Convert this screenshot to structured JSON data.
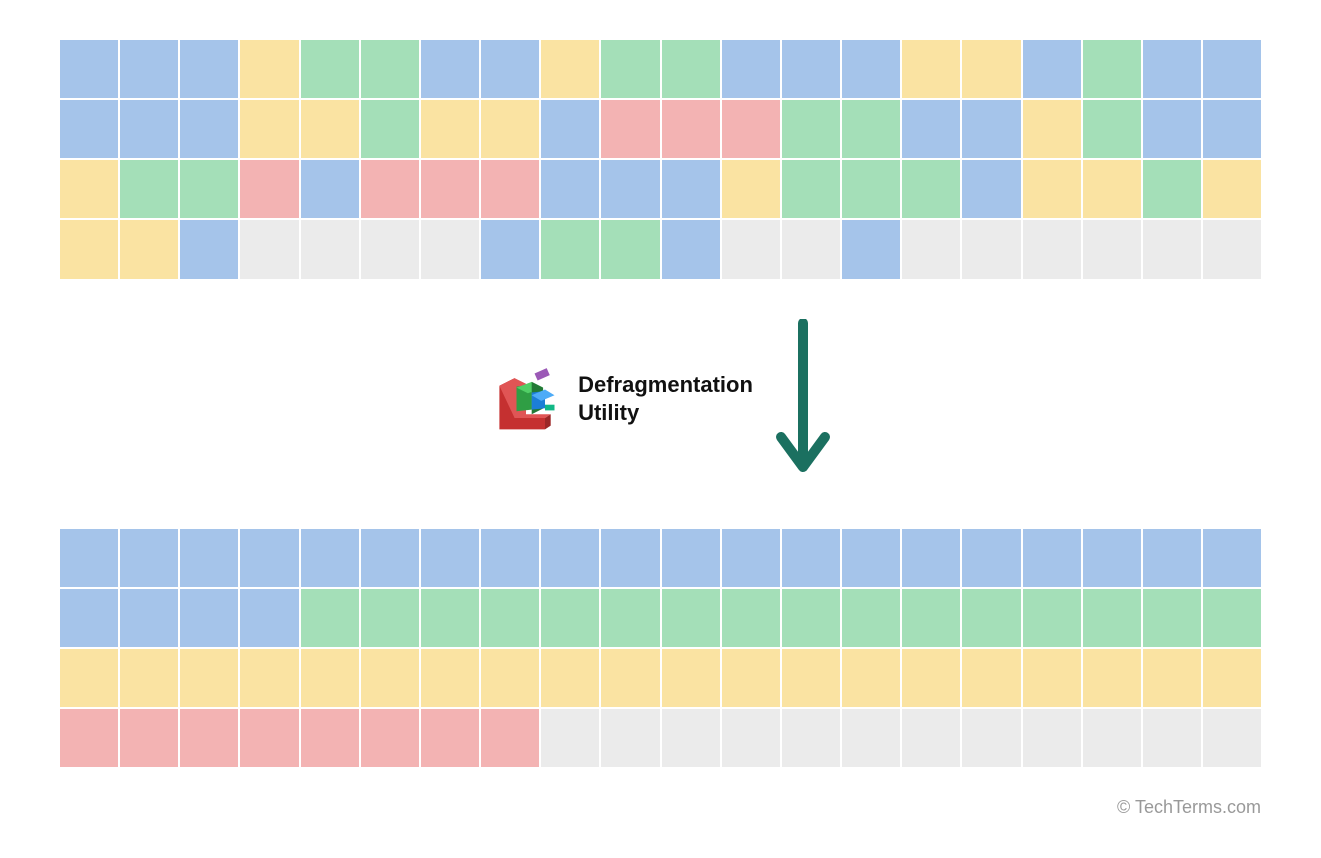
{
  "label": {
    "line1": "Defragmentation",
    "line2": "Utility"
  },
  "credit": "© TechTerms.com",
  "colors": {
    "blue": "#a5c4ea",
    "green": "#a4dfb8",
    "yellow": "#fae3a2",
    "red": "#f3b3b3",
    "gray": "#ebebeb",
    "arrow": "#1b7060"
  },
  "grids": {
    "columns": 20,
    "before": [
      [
        "blue",
        "blue",
        "blue",
        "yellow",
        "green",
        "green",
        "blue",
        "blue",
        "yellow",
        "green",
        "green",
        "blue",
        "blue",
        "blue",
        "yellow",
        "yellow",
        "blue",
        "green",
        "blue",
        "blue"
      ],
      [
        "blue",
        "blue",
        "blue",
        "yellow",
        "yellow",
        "green",
        "yellow",
        "yellow",
        "blue",
        "red",
        "red",
        "red",
        "green",
        "green",
        "blue",
        "blue",
        "yellow",
        "green",
        "blue",
        "blue"
      ],
      [
        "yellow",
        "green",
        "green",
        "red",
        "blue",
        "red",
        "red",
        "red",
        "blue",
        "blue",
        "blue",
        "yellow",
        "green",
        "green",
        "green",
        "blue",
        "yellow",
        "yellow",
        "green",
        "yellow"
      ],
      [
        "yellow",
        "yellow",
        "blue",
        "gray",
        "gray",
        "gray",
        "gray",
        "blue",
        "green",
        "green",
        "blue",
        "gray",
        "gray",
        "blue",
        "gray",
        "gray",
        "gray",
        "gray",
        "gray",
        "gray"
      ]
    ],
    "after": [
      [
        "blue",
        "blue",
        "blue",
        "blue",
        "blue",
        "blue",
        "blue",
        "blue",
        "blue",
        "blue",
        "blue",
        "blue",
        "blue",
        "blue",
        "blue",
        "blue",
        "blue",
        "blue",
        "blue",
        "blue"
      ],
      [
        "blue",
        "blue",
        "blue",
        "blue",
        "green",
        "green",
        "green",
        "green",
        "green",
        "green",
        "green",
        "green",
        "green",
        "green",
        "green",
        "green",
        "green",
        "green",
        "green",
        "green"
      ],
      [
        "yellow",
        "yellow",
        "yellow",
        "yellow",
        "yellow",
        "yellow",
        "yellow",
        "yellow",
        "yellow",
        "yellow",
        "yellow",
        "yellow",
        "yellow",
        "yellow",
        "yellow",
        "yellow",
        "yellow",
        "yellow",
        "yellow",
        "yellow"
      ],
      [
        "red",
        "red",
        "red",
        "red",
        "red",
        "red",
        "red",
        "red",
        "gray",
        "gray",
        "gray",
        "gray",
        "gray",
        "gray",
        "gray",
        "gray",
        "gray",
        "gray",
        "gray",
        "gray"
      ]
    ]
  }
}
